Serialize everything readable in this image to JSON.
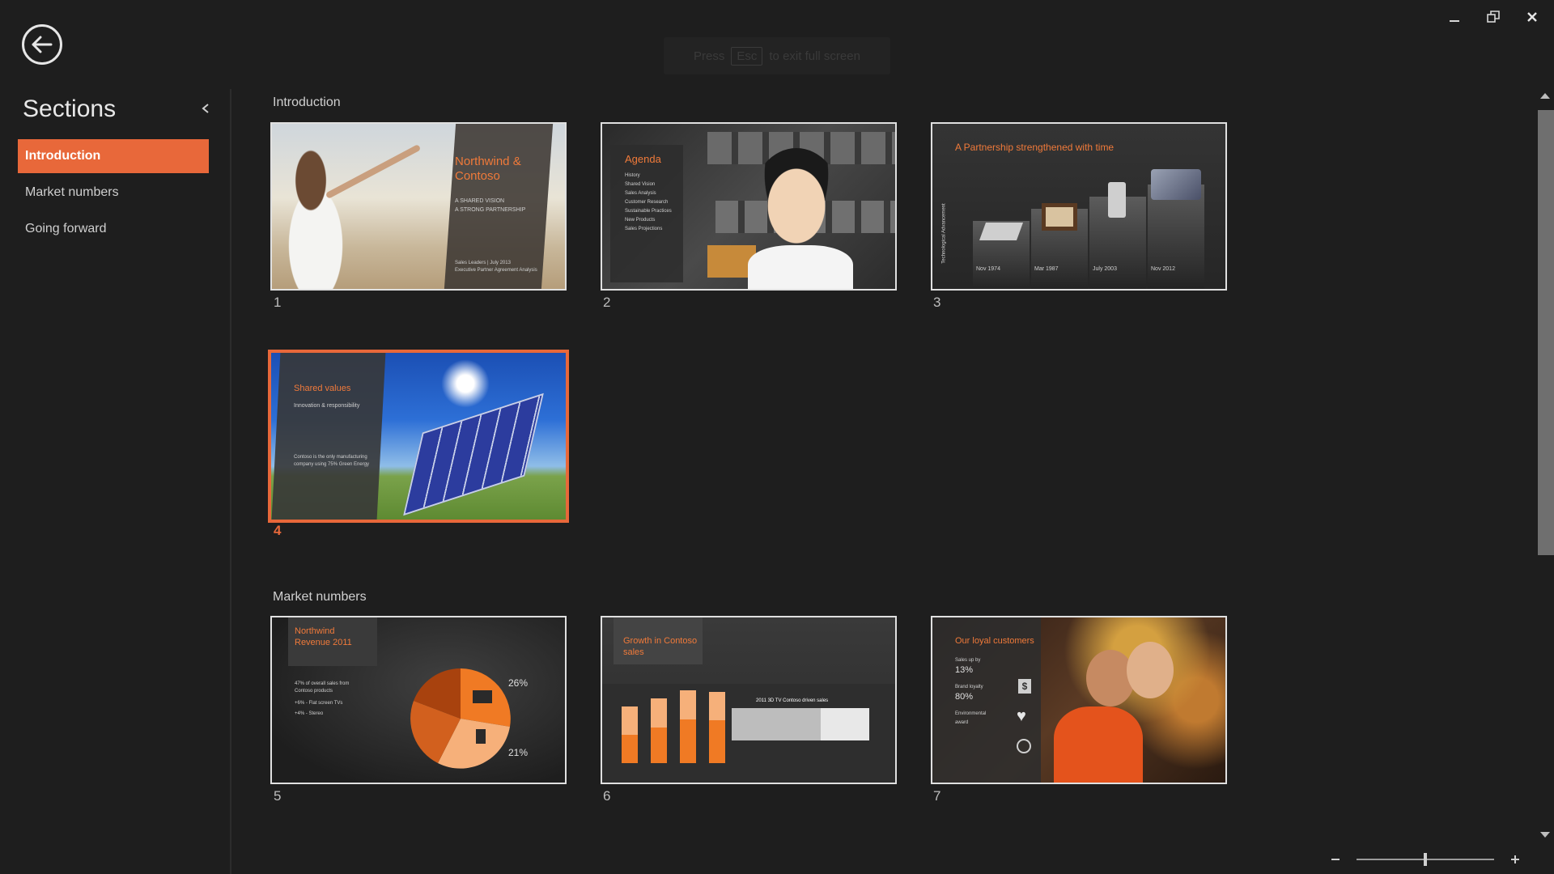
{
  "esc_hint": {
    "before": "Press",
    "key": "Esc",
    "after": "to exit full screen"
  },
  "sidebar": {
    "title": "Sections",
    "items": [
      {
        "label": "Introduction",
        "active": true
      },
      {
        "label": "Market numbers",
        "active": false
      },
      {
        "label": "Going forward",
        "active": false
      }
    ]
  },
  "groups": [
    {
      "label": "Introduction"
    },
    {
      "label": "Market numbers"
    }
  ],
  "slides": [
    {
      "number": "1",
      "title": "Northwind & Contoso",
      "subtitle_1": "A SHARED VISION",
      "subtitle_2": "A STRONG PARTNERSHIP",
      "footer_1": "Sales Leaders | July 2013",
      "footer_2": "Executive Partner Agreement Analysis"
    },
    {
      "number": "2",
      "title": "Agenda",
      "items": [
        "History",
        "Shared Vision",
        "Sales Analysis",
        "Customer Research",
        "Sustainable Practices",
        "New Products",
        "Sales Projections"
      ]
    },
    {
      "number": "3",
      "title": "A Partnership strengthened with time",
      "side_label": "Technological Advancement",
      "milestones": [
        "Nov 1974",
        "Mar 1987",
        "July 2003",
        "Nov 2012"
      ]
    },
    {
      "number": "4",
      "title": "Shared values",
      "subtitle": "Innovation & responsibility",
      "body": "Contoso is the only manufacturing company using 75% Green Energy"
    },
    {
      "number": "5",
      "title": "Northwind Revenue 2011",
      "body_1": "47% of overall sales from Contoso products",
      "body_2": "+6% - Flat screen TVs",
      "body_3": "+4% - Stereo",
      "pct_top": "26%",
      "pct_bottom": "21%"
    },
    {
      "number": "6",
      "title": "Growth in Contoso sales",
      "chart_caption": "2011 3D TV Contoso driven sales"
    },
    {
      "number": "7",
      "title": "Our loyal customers",
      "stat_1_label": "Sales up by",
      "stat_1_value": "13%",
      "stat_2_label": "Brand loyalty",
      "stat_2_value": "80%",
      "stat_3_label": "Environmental award"
    }
  ],
  "zoom": {
    "level": 0.5
  },
  "colors": {
    "accent": "#e8683a",
    "background": "#1e1e1e"
  }
}
